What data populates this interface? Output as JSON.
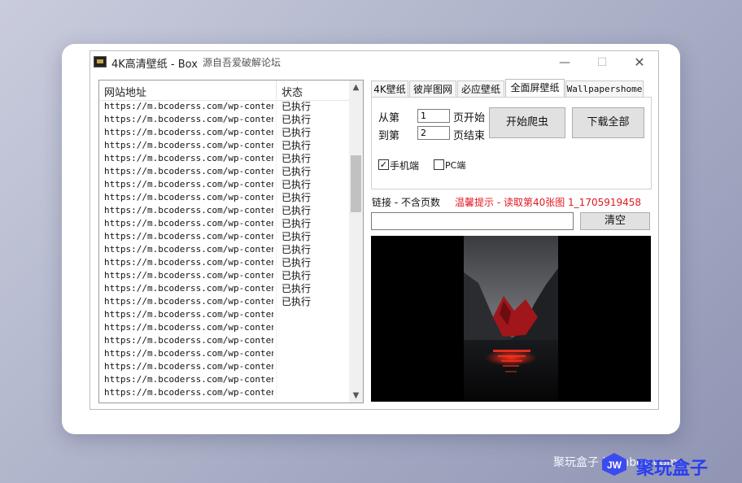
{
  "window": {
    "title": "4K高清壁纸 - Box",
    "subtitle": "源自吾爱破解论坛",
    "min_glyph": "—",
    "max_glyph": "☐",
    "close_glyph": "✕"
  },
  "list": {
    "header_url": "网站地址",
    "header_status": "状态",
    "rows": [
      {
        "url": "https://m.bcoderss.com/wp-conten...",
        "status": "已执行"
      },
      {
        "url": "https://m.bcoderss.com/wp-conten...",
        "status": "已执行"
      },
      {
        "url": "https://m.bcoderss.com/wp-conten...",
        "status": "已执行"
      },
      {
        "url": "https://m.bcoderss.com/wp-conten...",
        "status": "已执行"
      },
      {
        "url": "https://m.bcoderss.com/wp-conten...",
        "status": "已执行"
      },
      {
        "url": "https://m.bcoderss.com/wp-conten...",
        "status": "已执行"
      },
      {
        "url": "https://m.bcoderss.com/wp-conten...",
        "status": "已执行"
      },
      {
        "url": "https://m.bcoderss.com/wp-conten...",
        "status": "已执行"
      },
      {
        "url": "https://m.bcoderss.com/wp-conten...",
        "status": "已执行"
      },
      {
        "url": "https://m.bcoderss.com/wp-conten...",
        "status": "已执行"
      },
      {
        "url": "https://m.bcoderss.com/wp-conten...",
        "status": "已执行"
      },
      {
        "url": "https://m.bcoderss.com/wp-conten...",
        "status": "已执行"
      },
      {
        "url": "https://m.bcoderss.com/wp-conten...",
        "status": "已执行"
      },
      {
        "url": "https://m.bcoderss.com/wp-conten...",
        "status": "已执行"
      },
      {
        "url": "https://m.bcoderss.com/wp-conten...",
        "status": "已执行"
      },
      {
        "url": "https://m.bcoderss.com/wp-conten...",
        "status": "已执行"
      },
      {
        "url": "https://m.bcoderss.com/wp-conten...",
        "status": ""
      },
      {
        "url": "https://m.bcoderss.com/wp-conten...",
        "status": ""
      },
      {
        "url": "https://m.bcoderss.com/wp-conten...",
        "status": ""
      },
      {
        "url": "https://m.bcoderss.com/wp-conten...",
        "status": ""
      },
      {
        "url": "https://m.bcoderss.com/wp-conten...",
        "status": ""
      },
      {
        "url": "https://m.bcoderss.com/wp-conten...",
        "status": ""
      },
      {
        "url": "https://m.bcoderss.com/wp-conten...",
        "status": ""
      }
    ]
  },
  "tabs": [
    "4K壁纸",
    "彼岸图网",
    "必应壁纸",
    "全面屏壁纸",
    "Wallpapershome"
  ],
  "active_tab": "全面屏壁纸",
  "form": {
    "from_label": "从第",
    "from_value": "1",
    "page_start_label": "页开始",
    "to_label": "到第",
    "to_value": "2",
    "page_end_label": "页结束",
    "start_button": "开始爬虫",
    "download_button": "下载全部",
    "mobile_label": "手机端",
    "mobile_checked": true,
    "pc_label": "PC端",
    "pc_checked": false
  },
  "status": {
    "link_label": "链接 - 不含页数",
    "tip": "温馨提示 - 读取第40张图 1_1705919458",
    "tip_color": "#e0191f"
  },
  "url_input_value": "",
  "clear_button": "清空",
  "watermark": {
    "text": "聚玩盒子 jwenbox.com",
    "brand": "聚玩盒子",
    "logo_text": "JW"
  }
}
